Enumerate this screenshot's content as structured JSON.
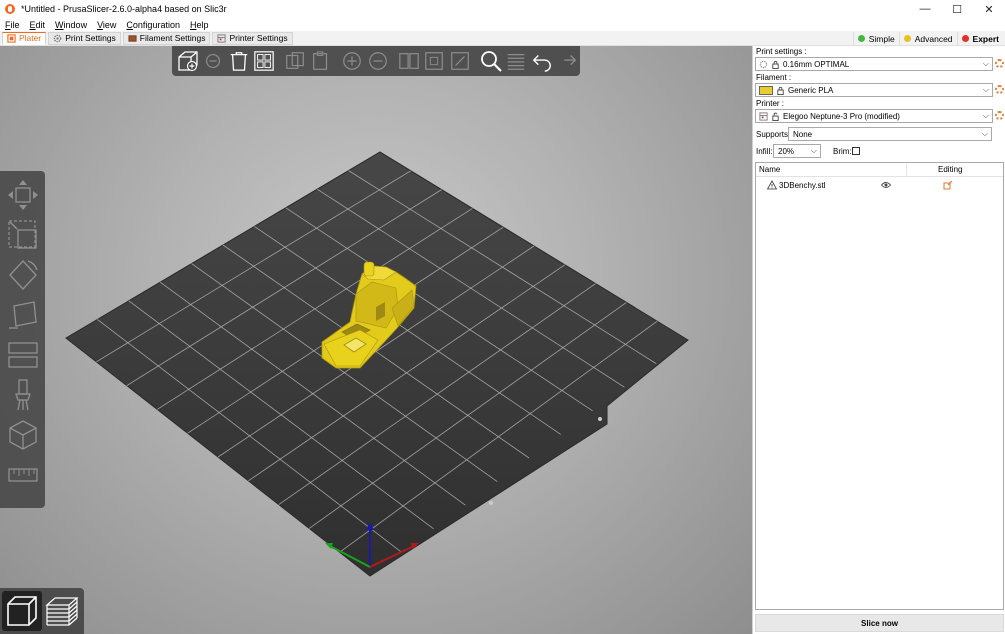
{
  "window": {
    "title": "*Untitled - PrusaSlicer-2.6.0-alpha4 based on Slic3r",
    "minimize": "—",
    "maximize": "☐",
    "close": "✕"
  },
  "menu": [
    {
      "label": "File",
      "key": "F"
    },
    {
      "label": "Edit",
      "key": "E"
    },
    {
      "label": "Window",
      "key": "W"
    },
    {
      "label": "View",
      "key": "V"
    },
    {
      "label": "Configuration",
      "key": "C"
    },
    {
      "label": "Help",
      "key": "H"
    }
  ],
  "tabs": {
    "plater": "Plater",
    "print_settings": "Print Settings",
    "filament_settings": "Filament Settings",
    "printer_settings": "Printer Settings"
  },
  "modes": {
    "simple": "Simple",
    "advanced": "Advanced",
    "expert": "Expert",
    "colors": {
      "simple": "#3fb93f",
      "advanced": "#e8c320",
      "expert": "#e0302a"
    }
  },
  "panel": {
    "print_settings_label": "Print settings :",
    "print_profile": "0.16mm OPTIMAL",
    "filament_label": "Filament :",
    "filament_profile": "Generic PLA",
    "filament_color": "#e5cd32",
    "printer_label": "Printer :",
    "printer_profile": "Elegoo Neptune-3 Pro (modified)",
    "supports_label": "Supports:",
    "supports_value": "None",
    "infill_label": "Infill:",
    "infill_value": "20%",
    "brim_label": "Brim:"
  },
  "object_list": {
    "col_name": "Name",
    "col_editing": "Editing",
    "objects": [
      {
        "name": "3DBenchy.stl"
      }
    ]
  },
  "slice_button": "Slice now",
  "colors": {
    "accent": "#ed6b21",
    "bed": "#3a3a3a",
    "model": "#e8d21c"
  }
}
